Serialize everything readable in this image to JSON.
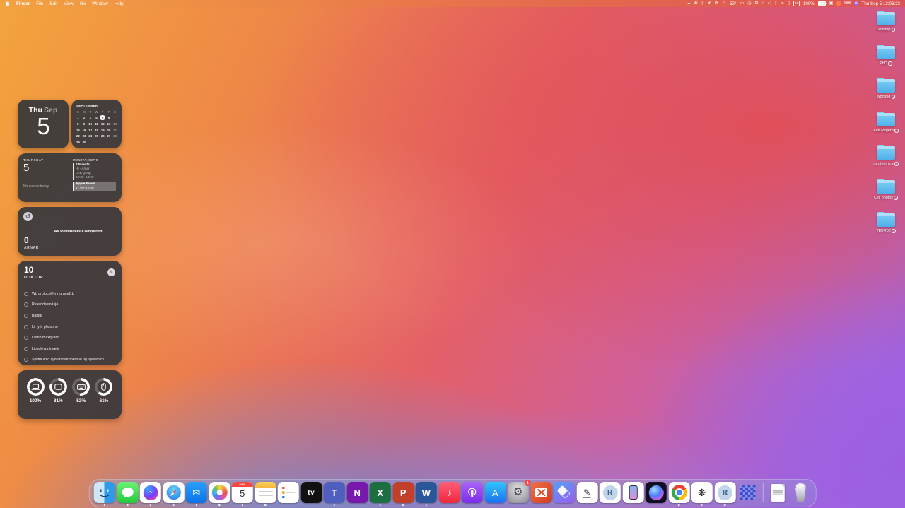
{
  "menu_bar": {
    "menus": [
      "Finder",
      "File",
      "Edit",
      "View",
      "Go",
      "Window",
      "Help"
    ],
    "status_items": [
      {
        "name": "cloud-icon",
        "type": "glyph",
        "glyph": "☁"
      },
      {
        "name": "flower-icon",
        "type": "glyph",
        "glyph": "❀"
      },
      {
        "name": "bluetooth-icon",
        "type": "glyph",
        "glyph": "ᛒ"
      },
      {
        "name": "brightness-icon",
        "type": "glyph",
        "glyph": "☀"
      },
      {
        "name": "sync-icon",
        "type": "glyph",
        "glyph": "⟳"
      },
      {
        "name": "face-icon",
        "type": "glyph",
        "glyph": "☺"
      },
      {
        "name": "temperature-text",
        "type": "text",
        "text": "52°"
      },
      {
        "name": "display-icon",
        "type": "glyph",
        "glyph": "▭"
      },
      {
        "name": "timer-icon",
        "type": "glyph",
        "glyph": "◷"
      },
      {
        "name": "grid-icon",
        "type": "glyph",
        "glyph": "⊞"
      },
      {
        "name": "home-icon",
        "type": "glyph",
        "glyph": "⌂"
      },
      {
        "name": "volume-icon",
        "type": "glyph",
        "glyph": "◁"
      },
      {
        "name": "bluetooth-icon-2",
        "type": "glyph",
        "glyph": "ᛒ"
      },
      {
        "name": "loop-icon",
        "type": "glyph",
        "glyph": "∞"
      },
      {
        "name": "phone-icon",
        "type": "glyph",
        "glyph": "▯"
      },
      {
        "name": "calendar-box-icon",
        "type": "box",
        "text": "15"
      },
      {
        "name": "battery-percent-text",
        "type": "text",
        "text": "100%"
      },
      {
        "name": "battery-icon",
        "type": "battery"
      },
      {
        "name": "cast-icon",
        "type": "glyph",
        "glyph": "▣"
      },
      {
        "name": "notification-icon",
        "type": "dot",
        "color": "#ff7a52"
      },
      {
        "name": "keyboard-icon",
        "type": "glyph",
        "glyph": "⌨"
      },
      {
        "name": "globe-icon",
        "type": "globe",
        "glyph": "⊕",
        "color": "#8f6ff0"
      },
      {
        "name": "clock-text",
        "type": "clock",
        "text": "Thu Sep 5  13:06:33"
      }
    ]
  },
  "widgets": {
    "date": {
      "weekday": "Thu",
      "month": "Sep",
      "day": "5"
    },
    "month_calendar": {
      "title": "SEPTEMBER",
      "day_headers": [
        "S",
        "M",
        "T",
        "W",
        "T",
        "F",
        "S"
      ],
      "weeks": [
        [
          1,
          2,
          3,
          4,
          5,
          6,
          7
        ],
        [
          8,
          9,
          10,
          11,
          12,
          13,
          14
        ],
        [
          15,
          16,
          17,
          18,
          19,
          20,
          21
        ],
        [
          22,
          23,
          24,
          25,
          26,
          27,
          28
        ],
        [
          29,
          30,
          "",
          "",
          "",
          "",
          ""
        ]
      ],
      "selected_day": 5
    },
    "events": {
      "left_weekday": "THURSDAY",
      "left_day": "5",
      "left_status": "No events today",
      "right_header": "MONDAY, SEP 9",
      "group_title": "2 Events",
      "event1_lines": [
        "HÍ - Arnar",
        "LAB group",
        "12:00–13:00"
      ],
      "event2_title": "Apple Event",
      "event2_time": "17:00–19:00"
    },
    "reminders": {
      "icon_glyph": "↺",
      "message": "All Reminders Completed",
      "count": "0",
      "list_name": "ARNAR"
    },
    "todo": {
      "count": "10",
      "list_name": "DOKTOR",
      "pencil_glyph": "✎",
      "items": [
        "Wb protocol fyrir gramd1b",
        "Rafeindasmásjá",
        "Baldur",
        "kit fyrir phospho",
        "Diann maxquant",
        "Ljosgleypnimælir",
        "Splitta lipid sýnum fyrir metabo og lipidomics"
      ]
    },
    "batteries": [
      {
        "icon": "laptop-icon",
        "percent": 100,
        "label": "100%"
      },
      {
        "icon": "trackpad-icon",
        "percent": 81,
        "label": "81%"
      },
      {
        "icon": "keyboard-icon",
        "percent": 52,
        "label": "52%"
      },
      {
        "icon": "mouse-icon",
        "percent": 61,
        "label": "61%"
      }
    ]
  },
  "desktop": {
    "folders": [
      {
        "label": "Desktop"
      },
      {
        "label": "PhD"
      },
      {
        "label": "Working"
      },
      {
        "label": "Eva Ritgerð"
      },
      {
        "label": "rproteomics"
      },
      {
        "label": "Cell photos"
      },
      {
        "label": "TEER08"
      }
    ]
  },
  "dock": {
    "items": [
      {
        "icon": "finder",
        "running": true
      },
      {
        "icon": "messages",
        "running": true
      },
      {
        "icon": "messenger",
        "running": true
      },
      {
        "icon": "safari",
        "running": true
      },
      {
        "icon": "mail",
        "running": true
      },
      {
        "icon": "photos",
        "running": true
      },
      {
        "icon": "calendar",
        "running": true,
        "month": "SEP",
        "day": "5"
      },
      {
        "icon": "notes",
        "running": true
      },
      {
        "icon": "reminders",
        "running": false
      },
      {
        "icon": "appletv",
        "running": false,
        "text": "tv"
      },
      {
        "icon": "teams",
        "running": true,
        "text": "T"
      },
      {
        "icon": "onenote",
        "running": false,
        "text": "N"
      },
      {
        "icon": "excel",
        "running": true,
        "text": "X"
      },
      {
        "icon": "powerpoint",
        "running": true,
        "text": "P"
      },
      {
        "icon": "word",
        "running": true,
        "text": "W"
      },
      {
        "icon": "music",
        "running": false
      },
      {
        "icon": "podcasts",
        "running": false
      },
      {
        "icon": "appstore",
        "running": false,
        "text": "A"
      },
      {
        "icon": "settings",
        "running": false,
        "badge": "1"
      },
      {
        "icon": "remote",
        "running": false
      },
      {
        "icon": "shortcuts",
        "running": false
      },
      {
        "icon": "journal",
        "running": false
      },
      {
        "icon": "rapp",
        "running": false,
        "text": "R"
      },
      {
        "icon": "iphone",
        "running": false
      },
      {
        "icon": "siri",
        "running": false
      },
      {
        "icon": "chrome",
        "running": true
      },
      {
        "icon": "chatgpt",
        "running": true
      },
      {
        "icon": "rapp2",
        "running": true,
        "text": "R"
      },
      {
        "icon": "knot",
        "running": false
      },
      {
        "type": "separator"
      },
      {
        "icon": "archive",
        "running": false
      },
      {
        "icon": "trash",
        "running": false
      }
    ]
  }
}
